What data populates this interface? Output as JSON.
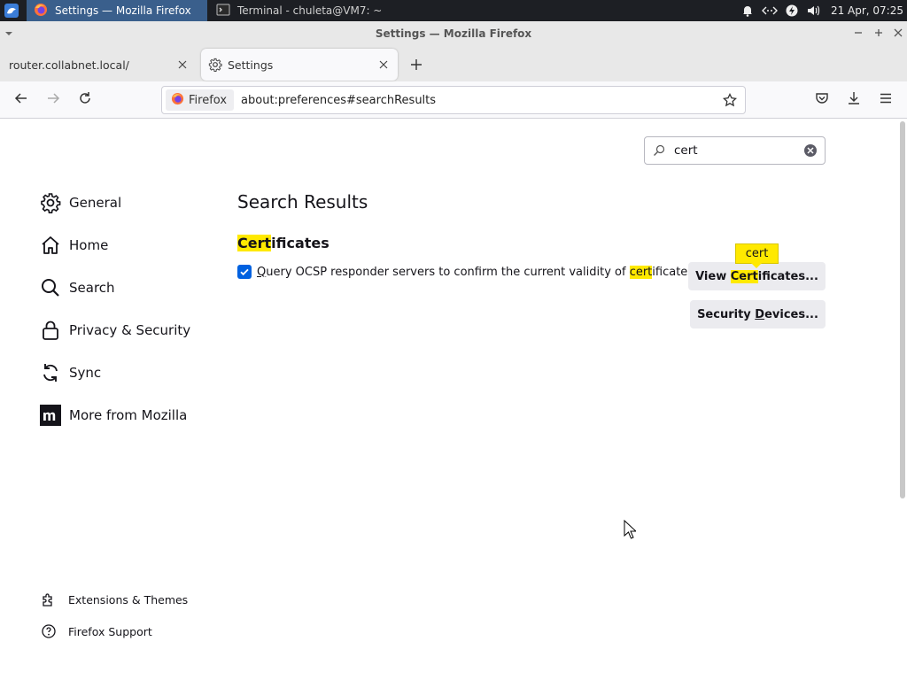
{
  "taskbar": {
    "tasks": [
      {
        "label": "Settings — Mozilla Firefox"
      },
      {
        "label": "Terminal - chuleta@VM7: ~"
      }
    ],
    "clock": "21 Apr, 07:25",
    "tray_icons": [
      "bell-icon",
      "network-icon",
      "power-icon",
      "volume-icon"
    ]
  },
  "window": {
    "title": "Settings — Mozilla Firefox"
  },
  "tabs": [
    {
      "label": "router.collabnet.local/",
      "active": false
    },
    {
      "label": "Settings",
      "active": true
    }
  ],
  "navbar": {
    "identity_label": "Firefox",
    "url": "about:preferences#searchResults"
  },
  "settings": {
    "search_value": "cert",
    "categories": [
      {
        "label": "General",
        "icon": "gear-icon"
      },
      {
        "label": "Home",
        "icon": "home-icon"
      },
      {
        "label": "Search",
        "icon": "search-icon"
      },
      {
        "label": "Privacy & Security",
        "icon": "lock-icon"
      },
      {
        "label": "Sync",
        "icon": "sync-icon"
      },
      {
        "label": "More from Mozilla",
        "icon": "mozilla-icon"
      }
    ],
    "footer_links": [
      {
        "label": "Extensions & Themes",
        "icon": "puzzle-icon"
      },
      {
        "label": "Firefox Support",
        "icon": "help-icon"
      }
    ],
    "results_title": "Search Results",
    "section": {
      "title_match": "Cert",
      "title_rest": "ificates"
    },
    "ocsp": {
      "checked": true,
      "text_accel": "Q",
      "text_before": "uery OCSP responder servers to confirm the current validity of ",
      "text_match": "cert",
      "text_after": "ificates"
    },
    "view_certificates": {
      "before": "View ",
      "match": "Cert",
      "after": "ificates..."
    },
    "security_devices": {
      "before": "Security ",
      "accel": "D",
      "after": "evices..."
    },
    "match_badge": "cert"
  },
  "colors": {
    "highlight": "#ffe900",
    "accent": "#0061e0",
    "taskbar": "#1d1f24",
    "active_task": "#3a5f8c"
  }
}
